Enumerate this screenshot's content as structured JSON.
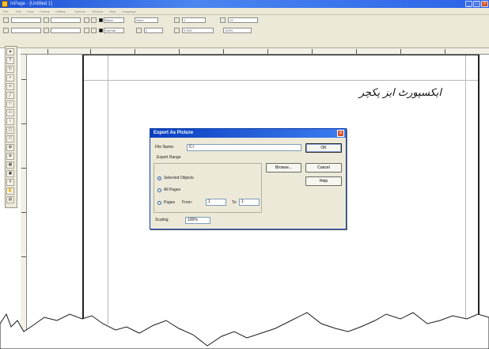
{
  "window": {
    "title": "InPage - [Untitled 1]",
    "menu": [
      "File",
      "Edit",
      "View",
      "Format",
      "Utilities",
      "Options",
      "Window",
      "Help",
      "Language"
    ],
    "toolbar": {
      "color_name": "Black",
      "color_name_2": "None",
      "style_name": "Normal",
      "width_value": "1",
      "font_size": "13",
      "tracking": "0",
      "angle": "0.000°",
      "shade": "100%"
    }
  },
  "document": {
    "urdu_text": "ایکسپورٹ ایز پکچر"
  },
  "dialog": {
    "title": "Export As Picture",
    "file_name_label": "File Name:",
    "file_name_value": "C:\\",
    "ok_label": "OK",
    "browse_label": "Browse...",
    "cancel_label": "Cancel",
    "help_label": "Help",
    "export_range_label": "Export Range",
    "opt_selected": "Selected Objects",
    "opt_all_pages": "All Pages",
    "opt_pages": "Pages",
    "from_label": "From:",
    "from_value": "1",
    "to_label": "To:",
    "to_value": "1",
    "scaling_label": "Scaling:",
    "scaling_value": "100%",
    "selected_option": "Selected Objects"
  },
  "colors": {
    "titlebar": "#2a63e8",
    "dialog_title": "#0a3fbf",
    "chrome": "#ece9d8"
  }
}
